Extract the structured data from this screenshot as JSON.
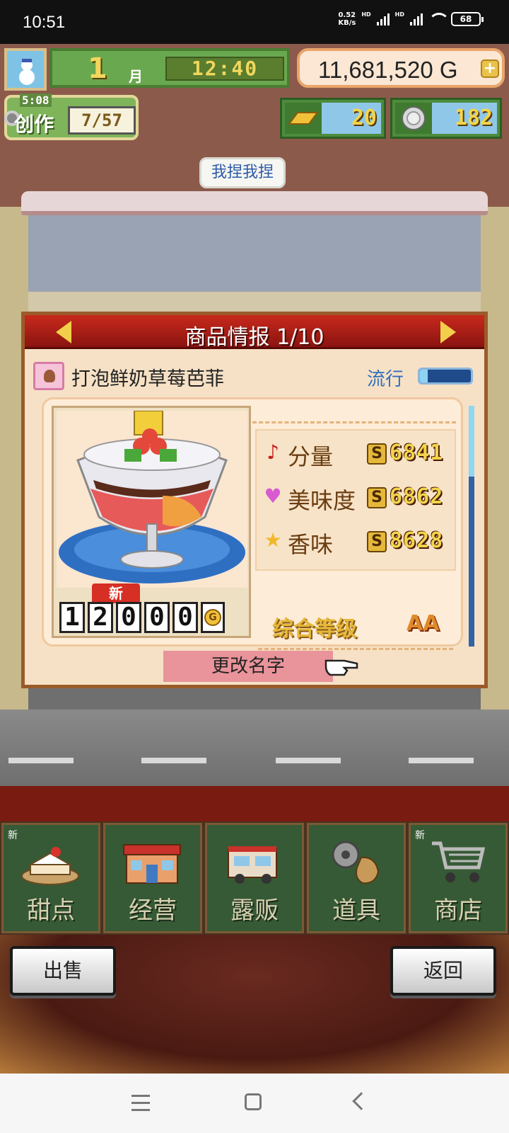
{
  "status_bar": {
    "time": "10:51",
    "net_speed_value": "0.52",
    "net_speed_unit": "KB/s",
    "hd_label": "HD",
    "battery": "68"
  },
  "hud": {
    "month": "1",
    "month_unit": "月",
    "clock": "12:40",
    "money": "11,681,520",
    "money_unit": "G",
    "plus_label": "+",
    "create_timer": "5:08",
    "create_label": "创作",
    "create_count": "7/57",
    "gold_bars": "20",
    "coins": "182"
  },
  "speech_bubble": "我捏我捏",
  "panel": {
    "title": "商品情报 1/10",
    "product_name": "打泡鲜奶草莓芭菲",
    "trend_label": "流行",
    "trend_level": 0.15,
    "new_tag": "新",
    "price_digits": [
      "1",
      "2",
      "0",
      "0",
      "0"
    ],
    "price_unit": "G",
    "stats": [
      {
        "icon": "music-note-icon",
        "label": "分量",
        "grade": "S",
        "value": "6841"
      },
      {
        "icon": "heart-icon",
        "label": "美味度",
        "grade": "S",
        "value": "6862"
      },
      {
        "icon": "star-icon",
        "label": "香味",
        "grade": "S",
        "value": "8628"
      }
    ],
    "overall_label": "综合等级",
    "overall_value": "AA",
    "rename_button": "更改名字"
  },
  "menu": [
    {
      "label": "甜点",
      "new": "新"
    },
    {
      "label": "经营",
      "new": ""
    },
    {
      "label": "露贩",
      "new": ""
    },
    {
      "label": "道具",
      "new": ""
    },
    {
      "label": "商店",
      "new": "新"
    }
  ],
  "buttons": {
    "sell": "出售",
    "back": "返回"
  },
  "colors": {
    "panel_header": "#b3221a",
    "accent_gold": "#f2d54b",
    "menu_green": "#365a35"
  }
}
